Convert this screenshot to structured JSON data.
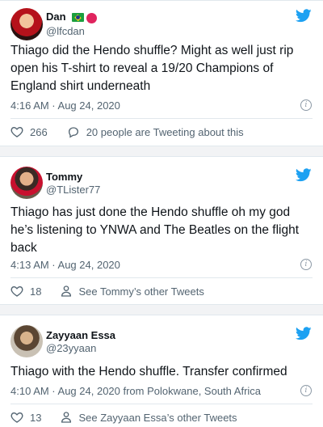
{
  "tweets": [
    {
      "display_name": "Dan",
      "handle": "@lfcdan",
      "text": "Thiago did the Hendo shuffle? Might as well just rip open his T-shirt to reveal a 19/20 Champions of England shirt underneath",
      "meta": "4:16 AM · Aug 24, 2020",
      "likes": "266",
      "secondary": "20 people are Tweeting about this",
      "secondary_icon": "speech-bubble-icon"
    },
    {
      "display_name": "Tommy",
      "handle": "@TLister77",
      "text": "Thiago has just done the Hendo shuffle oh my god he’s listening to YNWA and The Beatles on the flight back",
      "meta": "4:13 AM · Aug 24, 2020",
      "likes": "18",
      "secondary": "See Tommy’s other Tweets",
      "secondary_icon": "person-icon"
    },
    {
      "display_name": "Zayyaan Essa",
      "handle": "@23yyaan",
      "text": "Thiago with the Hendo shuffle. Transfer confirmed",
      "meta": "4:10 AM · Aug 24, 2020 from Polokwane, South Africa",
      "likes": "13",
      "secondary": "See Zayyaan Essa’s other Tweets",
      "secondary_icon": "person-icon"
    }
  ],
  "colors": {
    "twitter_blue": "#1da1f2",
    "muted": "#536471",
    "background": "#f2f3f5"
  }
}
